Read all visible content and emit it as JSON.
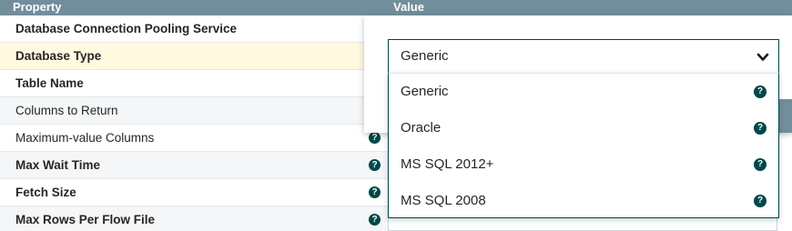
{
  "header": {
    "property": "Property",
    "value": "Value"
  },
  "properties": [
    {
      "label": "Database Connection Pooling Service",
      "bold": true
    },
    {
      "label": "Database Type",
      "bold": true
    },
    {
      "label": "Table Name",
      "bold": true
    },
    {
      "label": "Columns to Return",
      "bold": false
    },
    {
      "label": "Maximum-value Columns",
      "bold": false
    },
    {
      "label": "Max Wait Time",
      "bold": true
    },
    {
      "label": "Fetch Size",
      "bold": true
    },
    {
      "label": "Max Rows Per Flow File",
      "bold": true
    }
  ],
  "help_glyph": "?",
  "dropdown": {
    "selected": "Generic",
    "options": [
      "Generic",
      "Oracle",
      "MS SQL 2012+",
      "MS SQL 2008"
    ]
  },
  "colors": {
    "header": "#728e9b",
    "accent": "#004849",
    "selected_row": "#fff9df"
  }
}
